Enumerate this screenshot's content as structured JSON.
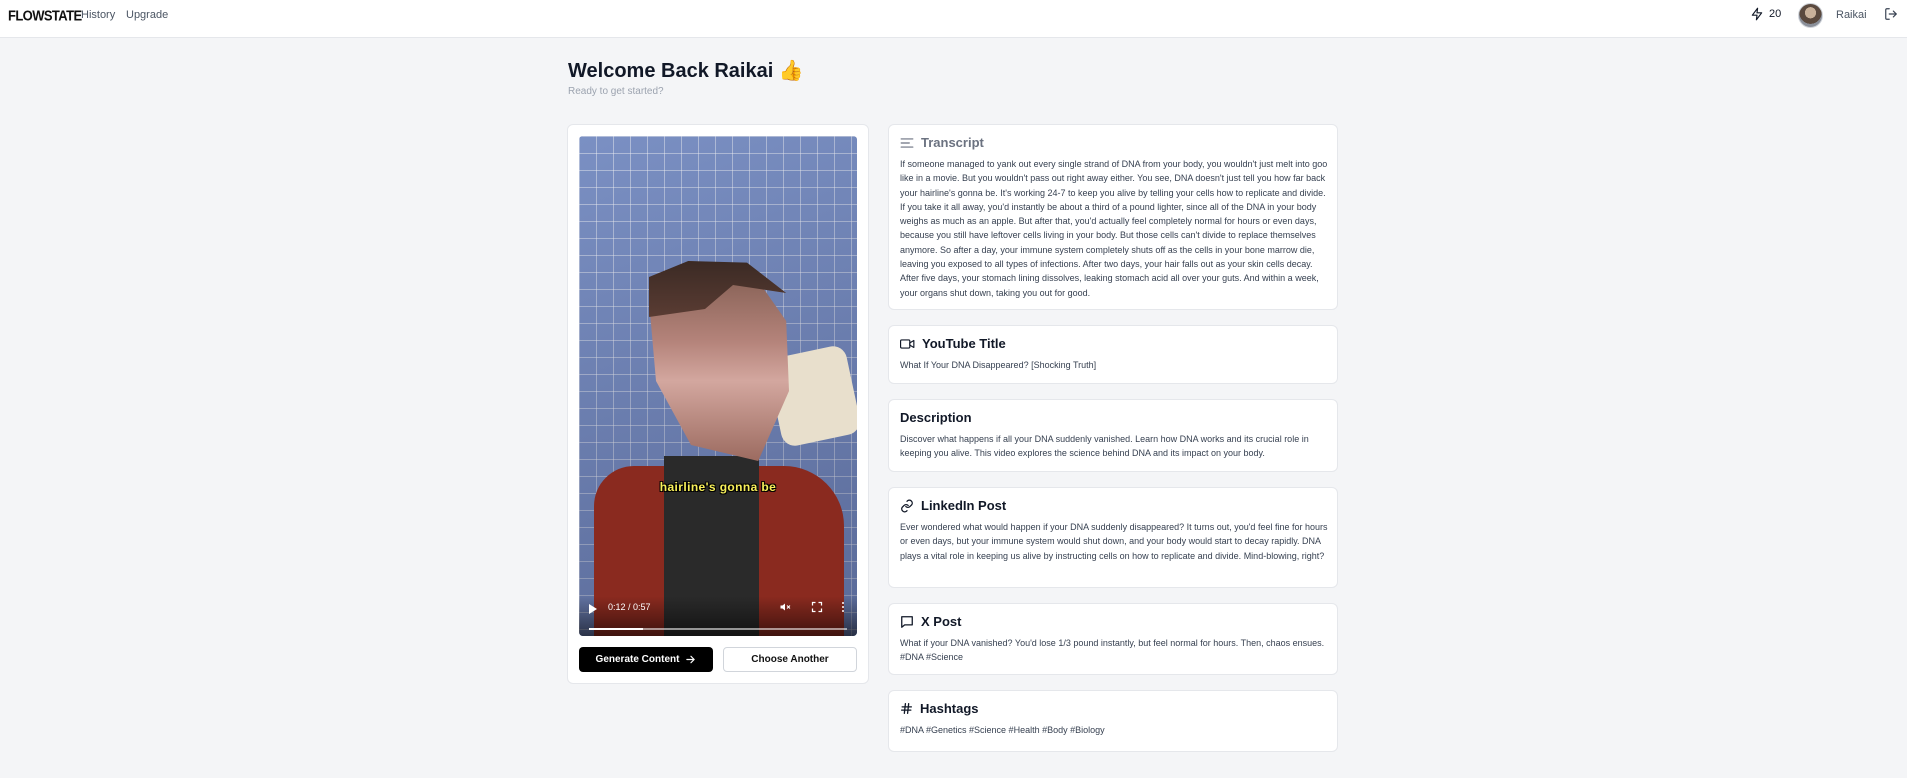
{
  "app": {
    "logo": "FLOWSTATE",
    "nav": {
      "history": "History",
      "upgrade": "Upgrade"
    },
    "credits": "20",
    "user_name": "Raikai"
  },
  "welcome": {
    "title": "Welcome Back Raikai 👍",
    "subtitle": "Ready to get started?"
  },
  "video": {
    "caption": "hairline's gonna be",
    "time": "0:12 / 0:57",
    "progress": 0.21,
    "generate_label": "Generate Content",
    "choose_label": "Choose Another"
  },
  "transcript": {
    "title": "Transcript",
    "text": "If someone managed to yank out every single strand of DNA from your body, you wouldn't just melt into goo like in a movie. But you wouldn't pass out right away either. You see, DNA doesn't just tell you how far back your hairline's gonna be. It's working 24-7 to keep you alive by telling your cells how to replicate and divide. If you take it all away, you'd instantly be about a third of a pound lighter, since all of the DNA in your body weighs as much as an apple. But after that, you'd actually feel completely normal for hours or even days, because you still have leftover cells living in your body. But those cells can't divide to replace themselves anymore. So after a day, your immune system completely shuts off as the cells in your bone marrow die, leaving you exposed to all types of infections. After two days, your hair falls out as your skin cells decay. After five days, your stomach lining dissolves, leaking stomach acid all over your guts. And within a week, your organs shut down, taking you out for good."
  },
  "youtube": {
    "title": "YouTube Title",
    "text": "What If Your DNA Disappeared? [Shocking Truth]"
  },
  "description": {
    "title": "Description",
    "text": "Discover what happens if all your DNA suddenly vanished. Learn how DNA works and its crucial role in keeping you alive. This video explores the science behind DNA and its impact on your body."
  },
  "linkedin": {
    "title": "LinkedIn Post",
    "text": "Ever wondered what would happen if your DNA suddenly disappeared? It turns out, you'd feel fine for hours or even days, but your immune system would shut down, and your body would start to decay rapidly. DNA plays a vital role in keeping us alive by instructing cells on how to replicate and divide. Mind-blowing, right?"
  },
  "xpost": {
    "title": "X Post",
    "text": "What if your DNA vanished? You'd lose 1/3 pound instantly, but feel normal for hours. Then, chaos ensues. #DNA #Science"
  },
  "hashtags": {
    "title": "Hashtags",
    "text": "#DNA #Genetics #Science #Health #Body #Biology"
  }
}
